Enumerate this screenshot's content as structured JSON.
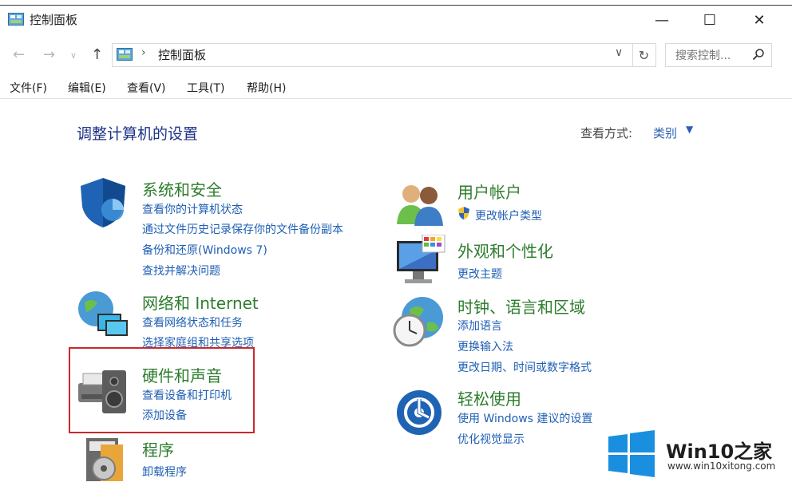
{
  "window": {
    "title": "控制面板",
    "controls": {
      "minimize": "—",
      "maximize": "☐",
      "close": "✕"
    }
  },
  "address": {
    "path": "控制面板",
    "search_placeholder": "搜索控制..."
  },
  "menu": [
    "文件(F)",
    "编辑(E)",
    "查看(V)",
    "工具(T)",
    "帮助(H)"
  ],
  "content": {
    "title": "调整计算机的设置",
    "view_by_label": "查看方式:",
    "view_by_value": "类别"
  },
  "categories": [
    {
      "title": "系统和安全",
      "icon": "shield-icon",
      "links": [
        "查看你的计算机状态",
        "通过文件历史记录保存你的文件备份副本",
        "备份和还原(Windows 7)",
        "查找并解决问题"
      ]
    },
    {
      "title": "网络和 Internet",
      "icon": "network-globe-icon",
      "links": [
        "查看网络状态和任务",
        "选择家庭组和共享选项"
      ]
    },
    {
      "title": "硬件和声音",
      "icon": "printer-speaker-icon",
      "links": [
        "查看设备和打印机",
        "添加设备"
      ]
    },
    {
      "title": "程序",
      "icon": "programs-disc-icon",
      "links": [
        "卸载程序"
      ]
    },
    {
      "title": "用户帐户",
      "icon": "users-icon",
      "links": [
        "更改帐户类型"
      ]
    },
    {
      "title": "外观和个性化",
      "icon": "monitor-palette-icon",
      "links": [
        "更改主题"
      ]
    },
    {
      "title": "时钟、语言和区域",
      "icon": "clock-globe-icon",
      "links": [
        "添加语言",
        "更换输入法",
        "更改日期、时间或数字格式"
      ]
    },
    {
      "title": "轻松使用",
      "icon": "ease-of-access-icon",
      "links": [
        "使用 Windows 建议的设置",
        "优化视觉显示"
      ]
    }
  ],
  "watermark": {
    "brand": "Win10之家",
    "url": "www.win10xitong.com"
  }
}
